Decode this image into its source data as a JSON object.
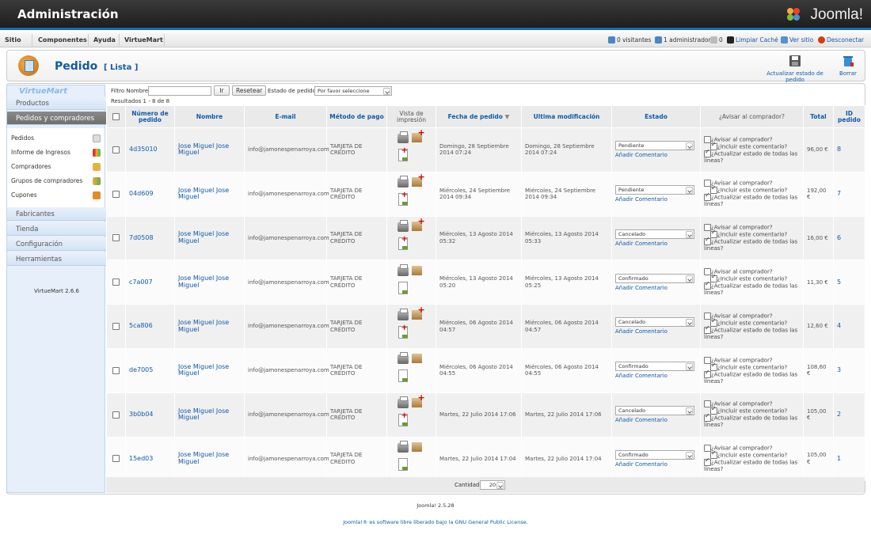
{
  "header": {
    "title": "Administración",
    "brand": "Joomla!"
  },
  "menu": {
    "items": [
      "Sitio",
      "Componentes",
      "Ayuda",
      "VirtueMart"
    ],
    "status": {
      "visitors": "0 visitantes",
      "admins": "1 administrador",
      "messages": "0",
      "clear_cache": "Limpiar Caché",
      "view_site": "Ver sitio",
      "logout": "Desconectar"
    }
  },
  "toolbar": {
    "title": "Pedido",
    "subtitle": "[ Lista ]",
    "update_label": "Actualizar estado de pedido",
    "delete_label": "Borrar"
  },
  "sidebar": {
    "logo": "VirtueMart",
    "sections": [
      "Productos",
      "Pedidos y compradores"
    ],
    "items": [
      "Pedidos",
      "Informe de Ingresos",
      "Compradores",
      "Grupos de compradores",
      "Cupones"
    ],
    "more_sections": [
      "Fabricantes",
      "Tienda",
      "Configuración",
      "Herramientas"
    ],
    "version": "VirtueMart 2.6.6"
  },
  "filter": {
    "name_label": "Filtro Nombre:",
    "name_value": "",
    "go_label": "Ir",
    "reset_label": "Resetear",
    "state_label": "Estado de pedido:",
    "state_value": "Por favor seleccione",
    "results": "Resultados 1 - 8 de 8"
  },
  "table": {
    "headers": [
      "",
      "Número de pedido",
      "Nombre",
      "E-mail",
      "Método de pago",
      "Vista de impresión",
      "Fecha de pedido",
      "Ultima modificación",
      "Estado",
      "¿Avisar al comprador?",
      "Total",
      "ID pedido"
    ],
    "notify_labels": [
      "¿Avisar al comprador?",
      "¿Incluir este comentario?",
      "¿Actualizar estado de todas las líneas?"
    ],
    "add_comment": "Añadir Comentario",
    "rows": [
      {
        "num": "4d35010",
        "name": "Jose Miguel Jose Miguel",
        "email": "info@jamonespenarroya.com",
        "payment": "TARJETA DE CRÉDITO",
        "shipped": true,
        "date": "Domingo, 28 Septiembre 2014 07:24",
        "modified": "Domingo, 28 Septiembre 2014 07:24",
        "state": "Pendiente",
        "total": "96,00 €",
        "id": "8"
      },
      {
        "num": "04d609",
        "name": "Jose Miguel Jose Miguel",
        "email": "info@jamonespenarroya.com",
        "payment": "TARJETA DE CRÉDITO",
        "shipped": true,
        "date": "Miércoles, 24 Septiembre 2014 09:34",
        "modified": "Miércoles, 24 Septiembre 2014 09:34",
        "state": "Pendiente",
        "total": "192,00 €",
        "id": "7"
      },
      {
        "num": "7d0508",
        "name": "Jose Miguel Jose Miguel",
        "email": "info@jamonespenarroya.com",
        "payment": "TARJETA DE CRÉDITO",
        "shipped": true,
        "date": "Miércoles, 13 Agosto 2014 05:32",
        "modified": "Miércoles, 13 Agosto 2014 05:33",
        "state": "Cancelado",
        "total": "16,00 €",
        "id": "6"
      },
      {
        "num": "c7a007",
        "name": "Jose Miguel Jose Miguel",
        "email": "info@jamonespenarroya.com",
        "payment": "TARJETA DE CRÉDITO",
        "shipped": false,
        "date": "Miércoles, 13 Agosto 2014 05:20",
        "modified": "Miércoles, 13 Agosto 2014 05:25",
        "state": "Confirmado",
        "total": "11,30 €",
        "id": "5"
      },
      {
        "num": "5ca806",
        "name": "Jose Miguel Jose Miguel",
        "email": "info@jamonespenarroya.com",
        "payment": "TARJETA DE CRÉDITO",
        "shipped": true,
        "date": "Miércoles, 06 Agosto 2014 04:57",
        "modified": "Miércoles, 06 Agosto 2014 04:57",
        "state": "Cancelado",
        "total": "12,60 €",
        "id": "4"
      },
      {
        "num": "de7005",
        "name": "Jose Miguel Jose Miguel",
        "email": "info@jamonespenarroya.com",
        "payment": "TARJETA DE CRÉDITO",
        "shipped": false,
        "date": "Miércoles, 06 Agosto 2014 04:55",
        "modified": "Miércoles, 06 Agosto 2014 04:55",
        "state": "Confirmado",
        "total": "108,60 €",
        "id": "3"
      },
      {
        "num": "3b0b04",
        "name": "Jose Miguel Jose Miguel",
        "email": "info@jamonespenarroya.com",
        "payment": "TARJETA DE CRÉDITO",
        "shipped": true,
        "date": "Martes, 22 Julio 2014 17:06",
        "modified": "Martes, 22 Julio 2014 17:06",
        "state": "Cancelado",
        "total": "105,00 €",
        "id": "2"
      },
      {
        "num": "15ed03",
        "name": "Jose Miguel Jose Miguel",
        "email": "info@jamonespenarroya.com",
        "payment": "TARJETA DE CRÉDITO",
        "shipped": false,
        "date": "Martes, 22 Julio 2014 17:04",
        "modified": "Martes, 22 Julio 2014 17:04",
        "state": "Confirmado",
        "total": "105,00 €",
        "id": "1"
      }
    ]
  },
  "pagination": {
    "label": "Cantidad",
    "value": "20"
  },
  "footer": {
    "version": "Joomla! 2.5.28",
    "license_prefix": "Joomla!® es software libre liberado bajo la",
    "license_link": "GNU General Public License."
  }
}
